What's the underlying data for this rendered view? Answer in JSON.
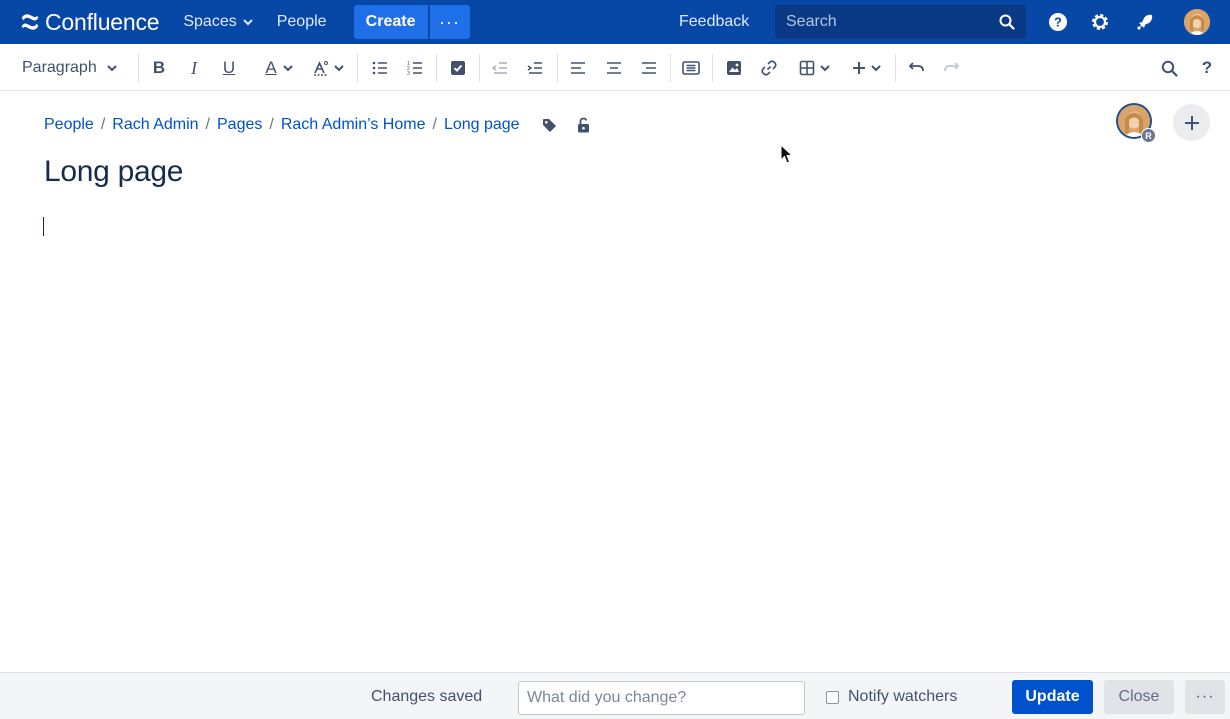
{
  "topnav": {
    "logo_text": "Confluence",
    "spaces_label": "Spaces",
    "people_label": "People",
    "create_label": "Create",
    "create_more_label": "···",
    "feedback_label": "Feedback",
    "search_placeholder": "Search",
    "icons": [
      "confluence-logo-icon",
      "chevron-down-icon",
      "search-icon",
      "help-icon",
      "settings-icon",
      "notifications-icon",
      "user-avatar"
    ],
    "bg_color": "#0747a6"
  },
  "toolbar": {
    "paragraph_label": "Paragraph",
    "bold_label": "B",
    "italic_label": "I",
    "underline_label": "U",
    "text_color_label": "A",
    "help_label": "?",
    "icons": [
      "bold-icon",
      "italic-icon",
      "underline-icon",
      "text-color-icon",
      "text-style-icon",
      "bullet-list-icon",
      "numbered-list-icon",
      "task-list-icon",
      "outdent-icon",
      "indent-icon",
      "align-left-icon",
      "align-center-icon",
      "align-right-icon",
      "layout-icon",
      "image-icon",
      "link-icon",
      "table-icon",
      "insert-more-icon",
      "undo-icon",
      "redo-icon",
      "find-replace-icon",
      "help-icon"
    ]
  },
  "breadcrumb": {
    "items": [
      "People",
      "Rach Admin",
      "Pages",
      "Rach Admin’s Home",
      "Long page"
    ],
    "separator": "/",
    "icons": [
      "label-tag-icon",
      "restrictions-lock-icon"
    ]
  },
  "page": {
    "title": "Long page",
    "collaborator_initial": "R"
  },
  "footer": {
    "status": "Changes saved",
    "change_placeholder": "What did you change?",
    "notify_label": "Notify watchers",
    "notify_checked": false,
    "update_label": "Update",
    "close_label": "Close",
    "more_label": "···",
    "primary_color": "#0052cc"
  }
}
